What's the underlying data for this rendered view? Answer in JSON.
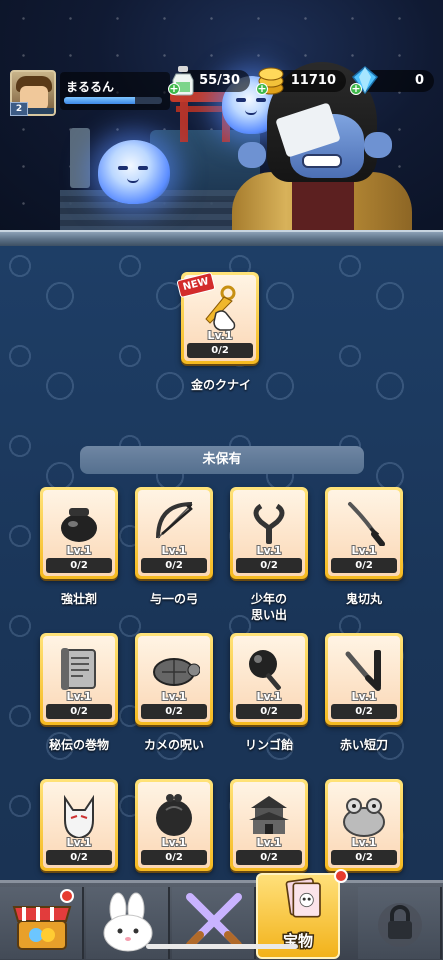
{
  "player": {
    "name": "まるるん",
    "level": "2",
    "xp_fraction": 0.72
  },
  "resources": {
    "stamina": "55/30",
    "gold": "11710",
    "gems": "0"
  },
  "featured": {
    "badge": "NEW",
    "item": {
      "name": "金のクナイ",
      "level": "Lv.1",
      "count": "0/2",
      "icon": "gold-kunai-icon"
    }
  },
  "section": {
    "title": "未保有"
  },
  "items": [
    {
      "name": "強壮剤",
      "level": "Lv.1",
      "count": "0/2",
      "icon": "tonic-pot-icon"
    },
    {
      "name": "与一の弓",
      "level": "Lv.1",
      "count": "0/2",
      "icon": "bow-icon"
    },
    {
      "name": "少年の\n思い出",
      "level": "Lv.1",
      "count": "0/2",
      "icon": "slingshot-icon"
    },
    {
      "name": "鬼切丸",
      "level": "Lv.1",
      "count": "0/2",
      "icon": "katana-icon"
    },
    {
      "name": "秘伝の巻物",
      "level": "Lv.1",
      "count": "0/2",
      "icon": "scroll-icon"
    },
    {
      "name": "カメの呪い",
      "level": "Lv.1",
      "count": "0/2",
      "icon": "turtle-icon"
    },
    {
      "name": "リンゴ飴",
      "level": "Lv.1",
      "count": "0/2",
      "icon": "candy-apple-icon"
    },
    {
      "name": "赤い短刀",
      "level": "Lv.1",
      "count": "0/2",
      "icon": "short-blade-icon"
    },
    {
      "name": "",
      "level": "Lv.1",
      "count": "0/2",
      "icon": "fox-mask-icon"
    },
    {
      "name": "",
      "level": "Lv.1",
      "count": "0/2",
      "icon": "coin-purse-icon"
    },
    {
      "name": "",
      "level": "Lv.1",
      "count": "0/2",
      "icon": "castle-icon"
    },
    {
      "name": "",
      "level": "Lv.1",
      "count": "0/2",
      "icon": "frog-icon"
    }
  ],
  "nav": {
    "tabs": [
      {
        "icon": "shop-icon",
        "label": "",
        "notify": true
      },
      {
        "icon": "rabbit-icon",
        "label": "",
        "notify": false
      },
      {
        "icon": "crossed-swords-icon",
        "label": "",
        "notify": false
      },
      {
        "icon": "treasure-icon",
        "label": "宝物",
        "notify": true,
        "active": true
      },
      {
        "icon": "lock-icon",
        "label": "",
        "notify": false
      }
    ]
  },
  "colors": {
    "card_border": "#f5b91f",
    "panel_bg": "#1e3e66",
    "notify_dot": "#e63b2e"
  }
}
